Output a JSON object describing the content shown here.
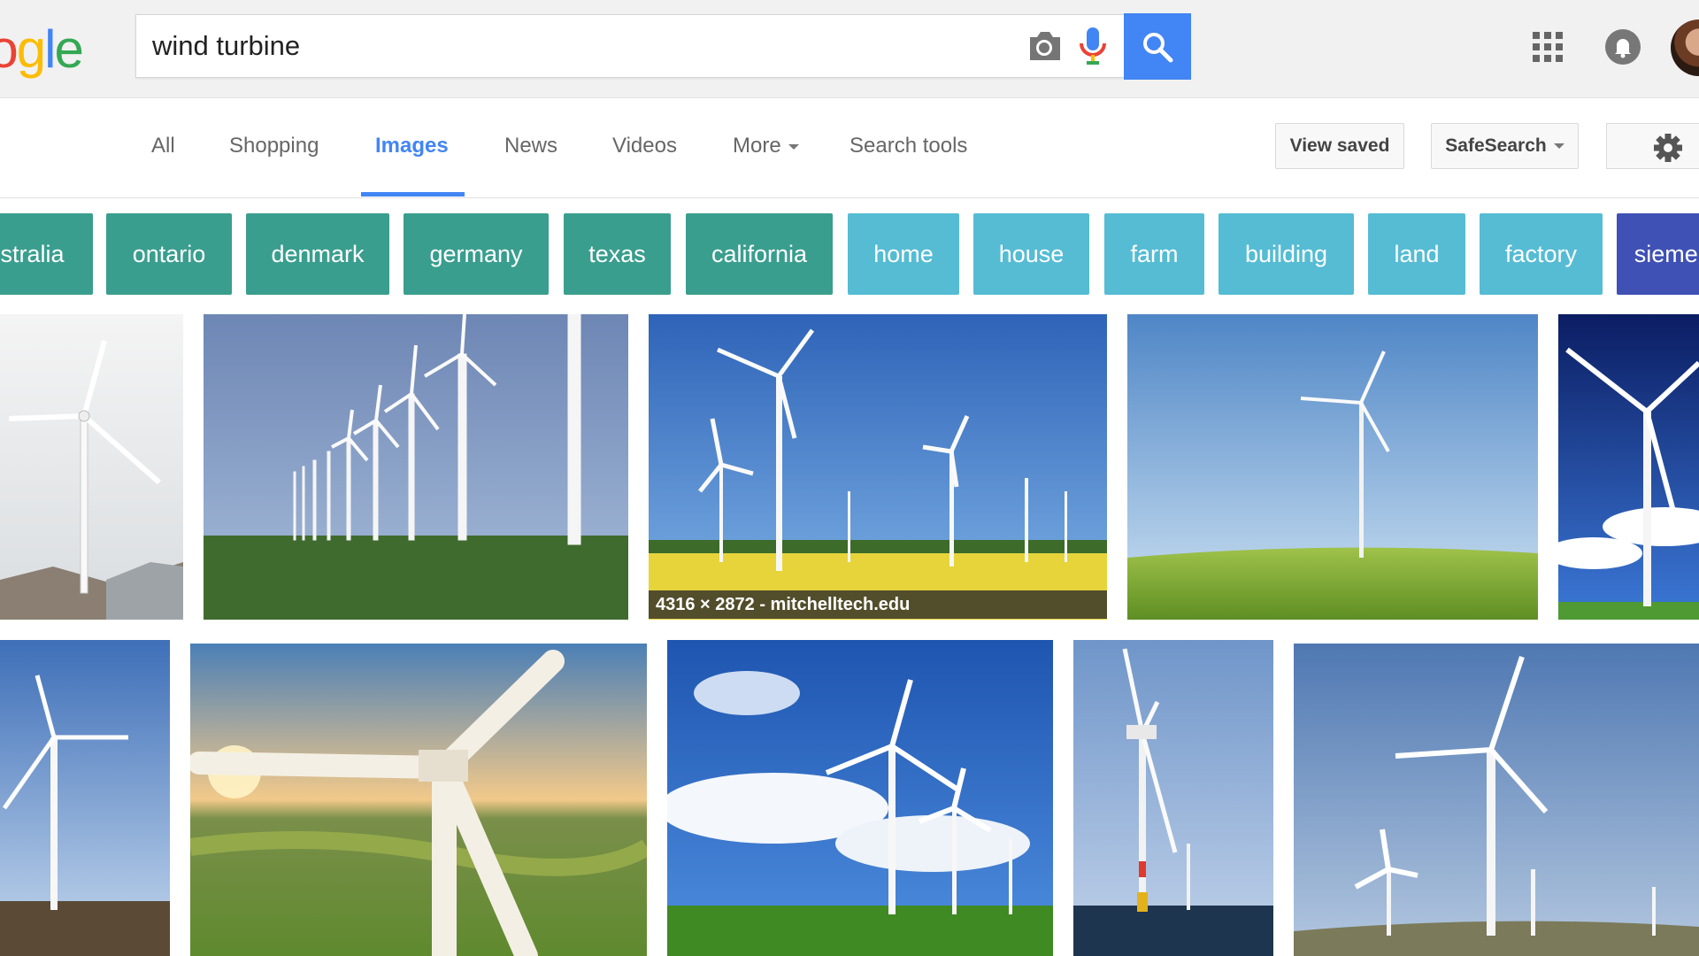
{
  "logo": {
    "p1": "o",
    "p2": "o",
    "p3": "g",
    "p4": "l",
    "p5": "e"
  },
  "search": {
    "query": "wind turbine"
  },
  "nav": {
    "tabs": [
      {
        "label": "All"
      },
      {
        "label": "Shopping"
      },
      {
        "label": "Images"
      },
      {
        "label": "News"
      },
      {
        "label": "Videos"
      },
      {
        "label": "More"
      },
      {
        "label": "Search tools"
      }
    ],
    "active_tab": "Images",
    "view_saved": "View saved",
    "safesearch": "SafeSearch"
  },
  "chips": [
    {
      "label": "australia",
      "color": "#3a9e8e"
    },
    {
      "label": "ontario",
      "color": "#3a9e8e"
    },
    {
      "label": "denmark",
      "color": "#3a9e8e"
    },
    {
      "label": "germany",
      "color": "#3a9e8e"
    },
    {
      "label": "texas",
      "color": "#3a9e8e"
    },
    {
      "label": "california",
      "color": "#3a9e8e"
    },
    {
      "label": "home",
      "color": "#55bcd4"
    },
    {
      "label": "house",
      "color": "#55bcd4"
    },
    {
      "label": "farm",
      "color": "#55bcd4"
    },
    {
      "label": "building",
      "color": "#55bcd4"
    },
    {
      "label": "land",
      "color": "#55bcd4"
    },
    {
      "label": "factory",
      "color": "#55bcd4"
    },
    {
      "label": "siemens",
      "color": "#3f51b5"
    }
  ],
  "results": {
    "caption": "4316 × 2872 - mitchelltech.edu"
  },
  "colors": {
    "accent": "#4285f4",
    "header_bg": "#f1f1f1"
  }
}
